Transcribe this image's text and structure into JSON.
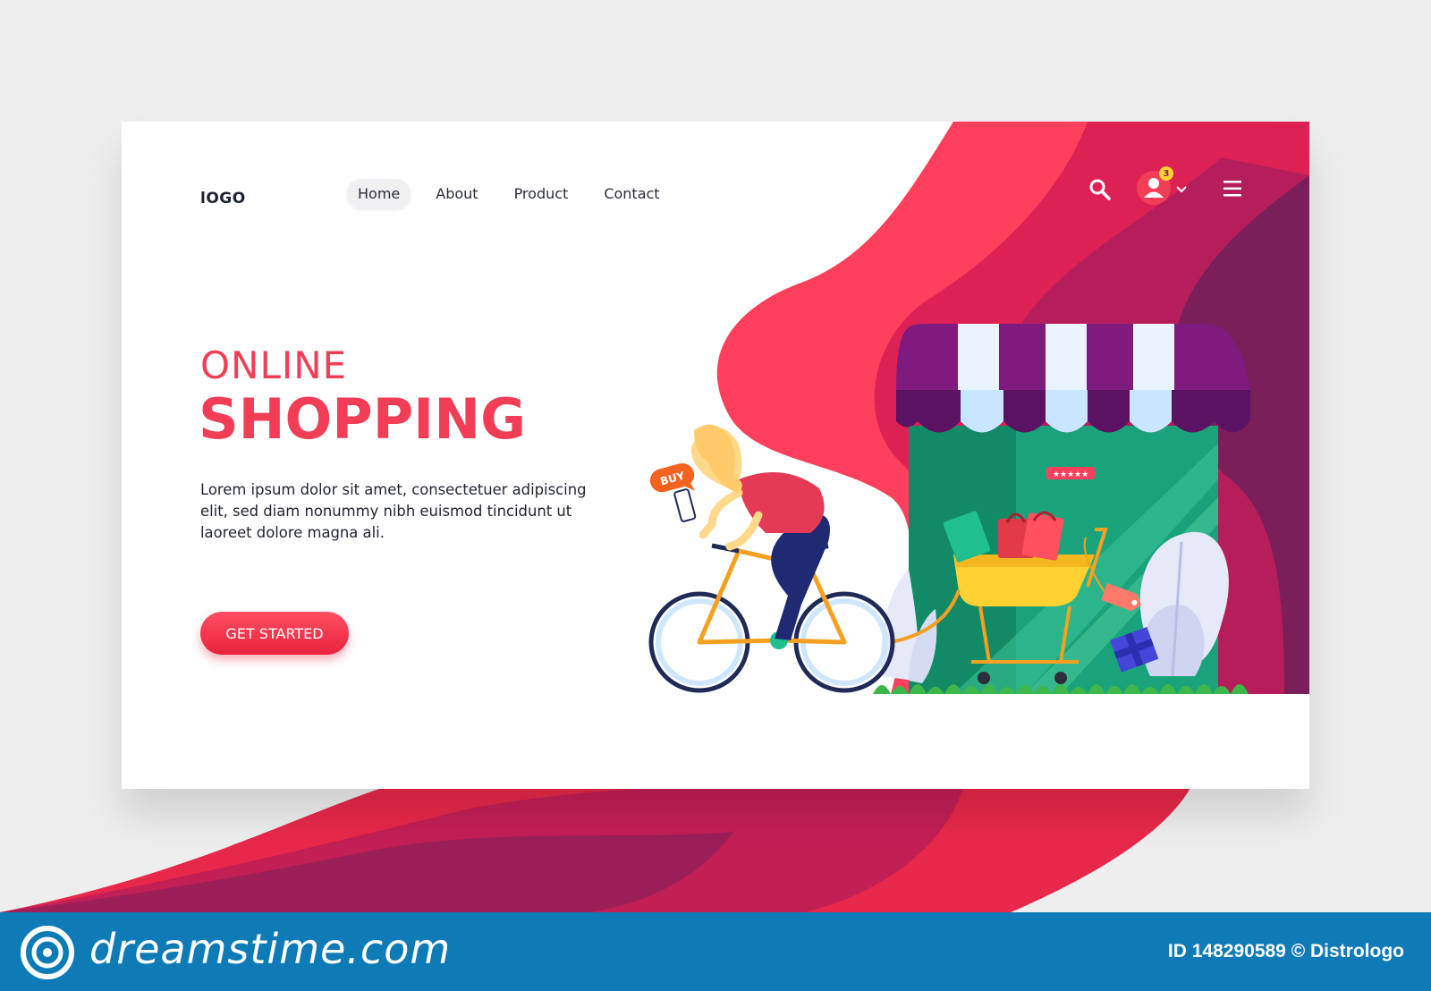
{
  "header": {
    "logo": "lOGO",
    "nav": [
      "Home",
      "About",
      "Product",
      "Contact"
    ],
    "active_nav": "Home",
    "notification_count": "3"
  },
  "hero": {
    "title_line1": "ONLINE",
    "title_line2": "SHOPPING",
    "text": "Lorem ipsum dolor sit amet, consectetuer adipiscing elit, sed diam nonummy nibh euismod tincidunt ut laoreet dolore magna ali.",
    "cta": "GET STARTED"
  },
  "illustration": {
    "speech_bubble": "BUY",
    "sign_text": "★★★★★"
  },
  "footer": {
    "brand": "dreamstime.com",
    "image_id": "ID 148290589 © Distrologo"
  },
  "colors": {
    "accent": "#f23d57",
    "wave_dark": "#7a1f5a",
    "wave_mid": "#c21f55",
    "footer_bg": "#0e7bb7"
  }
}
